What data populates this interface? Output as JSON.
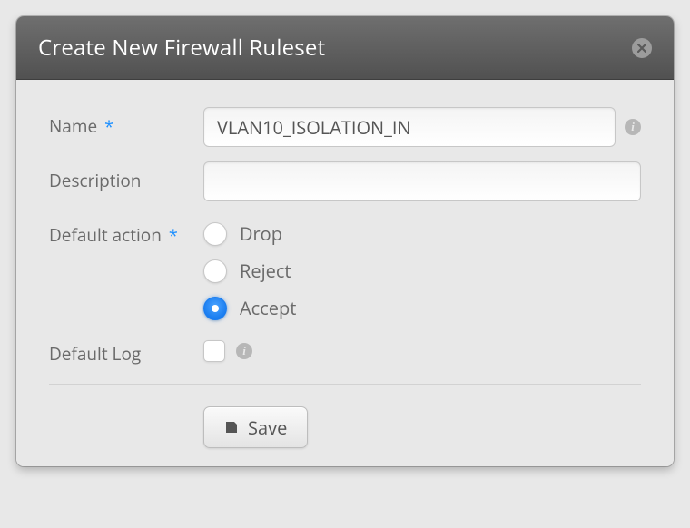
{
  "modal": {
    "title": "Create New Firewall Ruleset"
  },
  "form": {
    "name": {
      "label": "Name",
      "required": "*",
      "value": "VLAN10_ISOLATION_IN"
    },
    "description": {
      "label": "Description",
      "value": ""
    },
    "default_action": {
      "label": "Default action",
      "required": "*",
      "options": {
        "drop": "Drop",
        "reject": "Reject",
        "accept": "Accept"
      },
      "selected": "accept"
    },
    "default_log": {
      "label": "Default Log",
      "checked": false
    }
  },
  "buttons": {
    "save": "Save"
  }
}
